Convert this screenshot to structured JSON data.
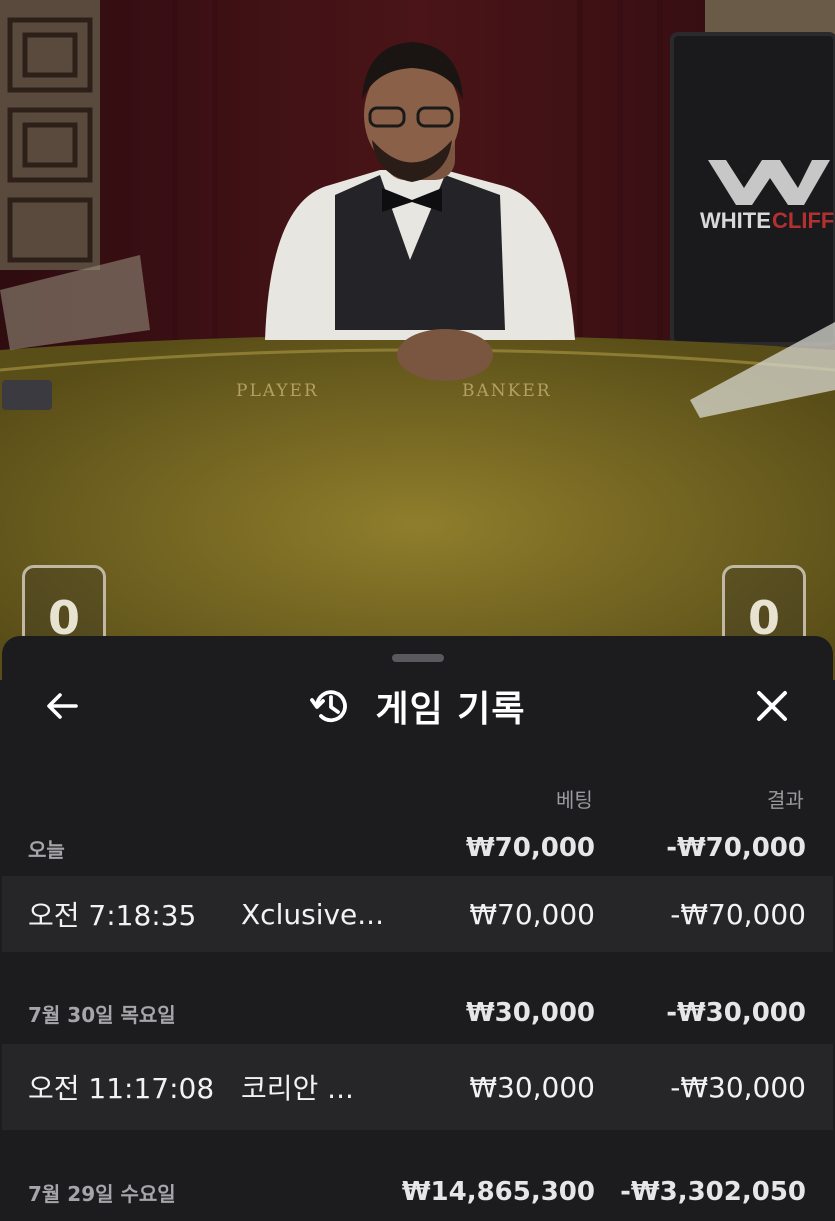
{
  "video": {
    "table_labels": {
      "player": "PLAYER",
      "banker": "BANKER"
    },
    "brand": {
      "part1": "WHITE",
      "part2": "CLIFF"
    },
    "scores": {
      "player": "0",
      "banker": "0"
    }
  },
  "sheet": {
    "title": "게임 기록",
    "icons": {
      "back": "arrow-left-icon",
      "history": "history-icon",
      "close": "close-icon"
    },
    "columns": {
      "bet": "베팅",
      "result": "결과"
    },
    "groups": [
      {
        "date": "오늘",
        "total_bet": "₩70,000",
        "total_result": "-₩70,000",
        "items": [
          {
            "time": "오전 7:18:35",
            "game": "Xclusive...",
            "bet": "₩70,000",
            "result": "-₩70,000"
          }
        ]
      },
      {
        "date": "7월 30일 목요일",
        "total_bet": "₩30,000",
        "total_result": "-₩30,000",
        "items": [
          {
            "time": "오전 11:17:08",
            "game": "코리안 ...",
            "bet": "₩30,000",
            "result": "-₩30,000"
          }
        ]
      },
      {
        "date": "7월 29일 수요일",
        "total_bet": "₩14,865,300",
        "total_result": "-₩3,302,050",
        "items": []
      }
    ]
  },
  "colors": {
    "sheet_bg": "#1c1c1e",
    "row_bg": "#262628",
    "text_primary": "#ffffff",
    "text_secondary": "#9a9a9e",
    "table_felt": "#8a7a2a",
    "curtain": "#4a1416"
  }
}
